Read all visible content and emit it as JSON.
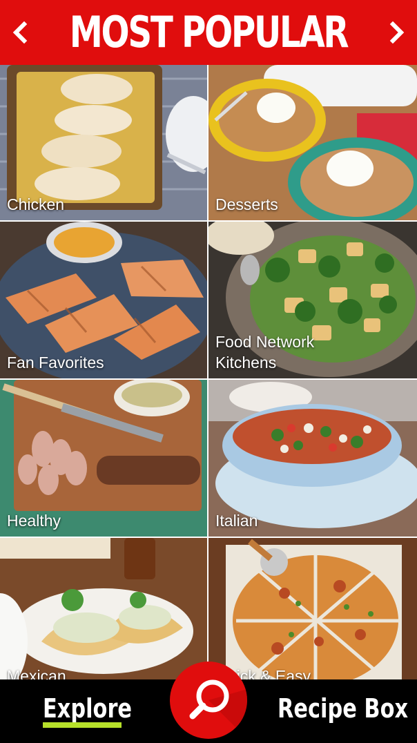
{
  "header": {
    "title": "MOST POPULAR",
    "prev_icon": "chevron-left-icon",
    "next_icon": "chevron-right-icon"
  },
  "categories": [
    {
      "label": "Chicken"
    },
    {
      "label": "Desserts"
    },
    {
      "label": "Fan Favorites"
    },
    {
      "label": "Food Network\nKitchens"
    },
    {
      "label": "Healthy"
    },
    {
      "label": "Italian"
    },
    {
      "label": "Mexican"
    },
    {
      "label": "Quick & Easy"
    }
  ],
  "tabbar": {
    "explore_label": "Explore",
    "recipe_box_label": "Recipe Box",
    "search_icon": "search-icon"
  },
  "colors": {
    "brand_red": "#e00d0d",
    "active_underline": "#b6e02a"
  }
}
